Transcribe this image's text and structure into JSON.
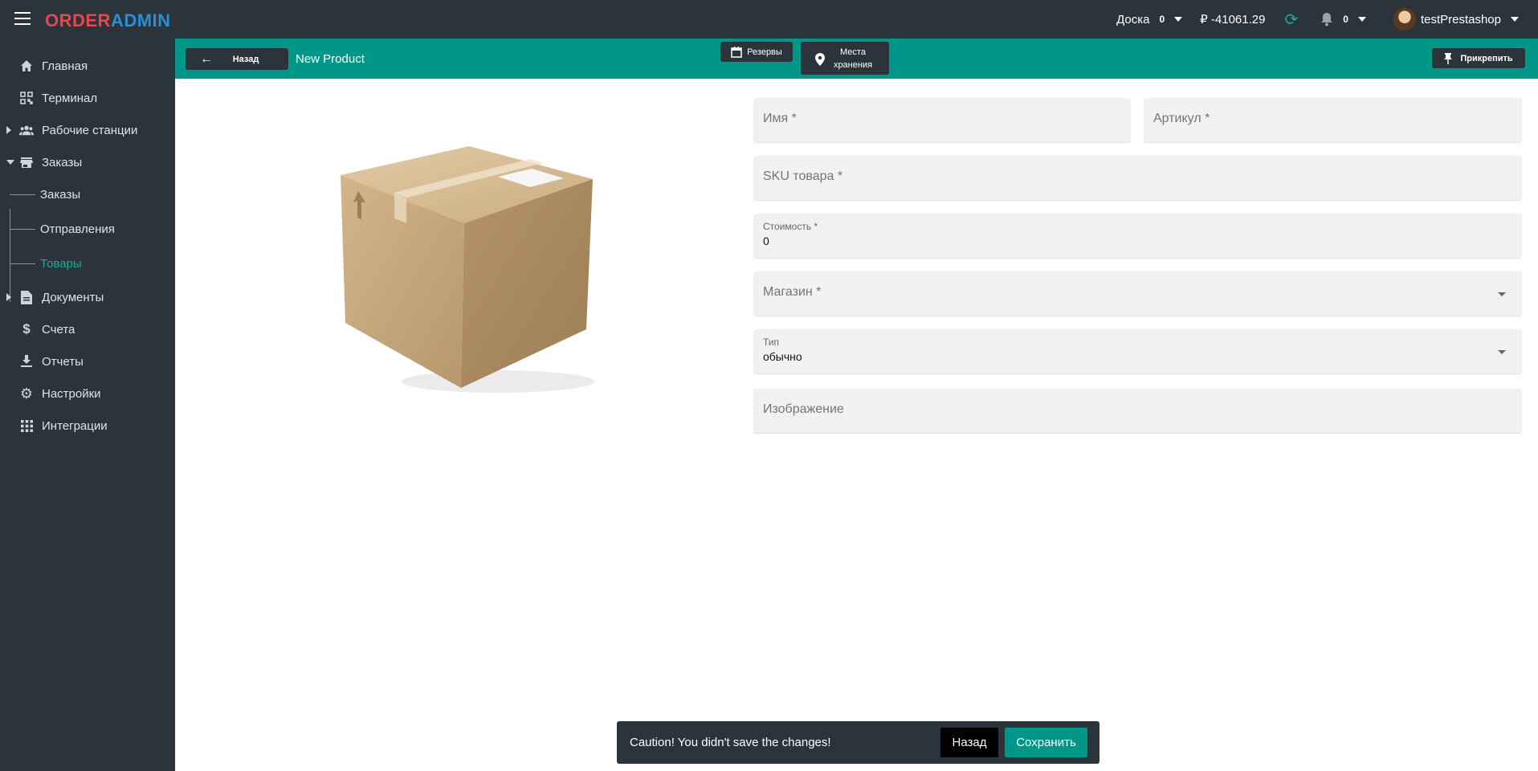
{
  "header": {
    "logo_part1": "ORDER",
    "logo_part2": "ADMIN",
    "board_label": "Доска",
    "board_count": "0",
    "balance": "₽ -41061.29",
    "notifications_count": "0",
    "username": "testPrestashop"
  },
  "sidebar": {
    "items": [
      {
        "label": "Главная",
        "icon": "home-icon"
      },
      {
        "label": "Терминал",
        "icon": "qr-code-icon"
      },
      {
        "label": "Рабочие станции",
        "icon": "people-icon"
      },
      {
        "label": "Заказы",
        "icon": "store-icon"
      },
      {
        "label": "Документы",
        "icon": "document-icon"
      },
      {
        "label": "Счета",
        "icon": "dollar-icon"
      },
      {
        "label": "Отчеты",
        "icon": "download-icon"
      },
      {
        "label": "Настройки",
        "icon": "gear-icon"
      },
      {
        "label": "Интеграции",
        "icon": "grid-icon"
      }
    ],
    "orders_subitems": [
      {
        "label": "Заказы"
      },
      {
        "label": "Отправления"
      },
      {
        "label": "Товары"
      }
    ],
    "active_color": "#1fa99a"
  },
  "actionbar": {
    "back_label": "Назад",
    "title": "New Product",
    "reserves_label": "Резервы",
    "locations_line1": "Места",
    "locations_line2": "хранения",
    "pin_label": "Прикрепить",
    "color": "#009688"
  },
  "form": {
    "name_placeholder": "Имя *",
    "article_placeholder": "Артикул *",
    "sku_placeholder": "SKU товара *",
    "cost_label": "Стоимость *",
    "cost_value": "0",
    "shop_placeholder": "Магазин *",
    "type_label": "Тип",
    "type_value": "обычно",
    "image_placeholder": "Изображение"
  },
  "snackbar": {
    "message": "Caution! You didn't save the changes!",
    "back_label": "Назад",
    "save_label": "Сохранить"
  }
}
